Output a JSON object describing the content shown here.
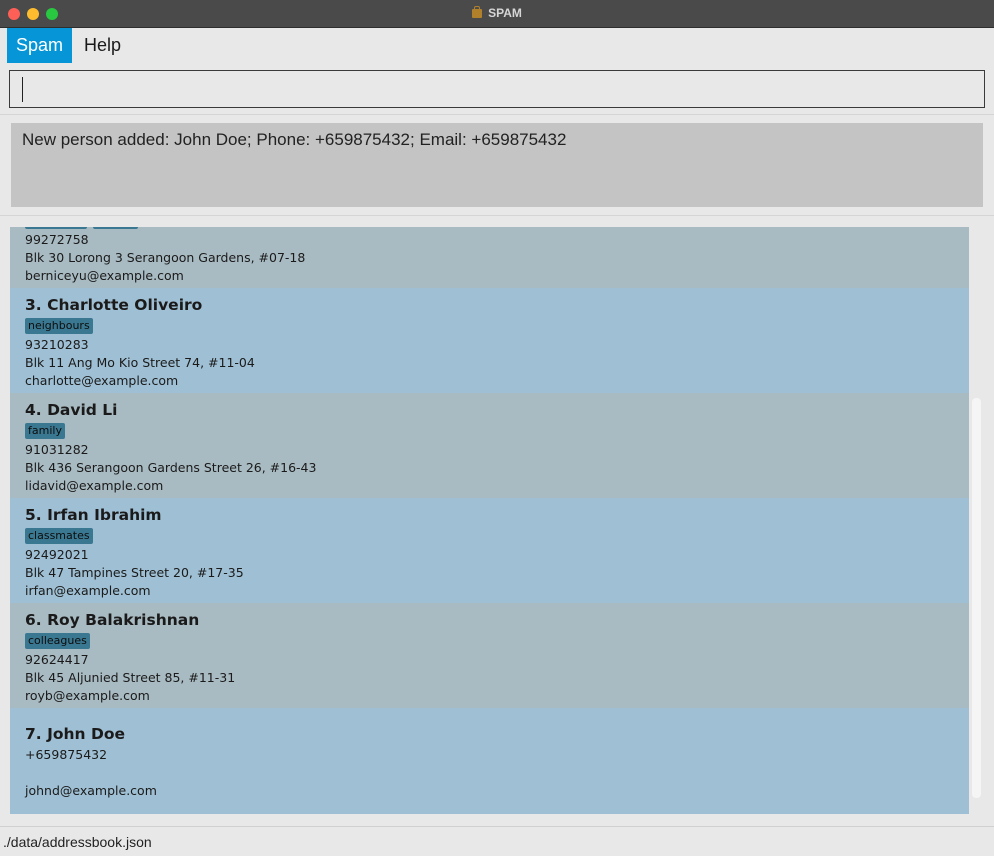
{
  "window": {
    "title": "SPAM"
  },
  "menu": {
    "items": [
      "Spam",
      "Help"
    ]
  },
  "command": {
    "value": "",
    "placeholder": ""
  },
  "result": {
    "message": "New person added: John Doe; Phone: +659875432; Email: +659875432"
  },
  "persons_partial": {
    "phone": "99272758",
    "address": "Blk 30 Lorong 3 Serangoon Gardens, #07-18",
    "email": "berniceyu@example.com"
  },
  "persons": [
    {
      "name": "3.  Charlotte Oliveiro",
      "tag": "neighbours",
      "phone": "93210283",
      "address": "Blk 11 Ang Mo Kio Street 74, #11-04",
      "email": "charlotte@example.com"
    },
    {
      "name": "4.  David Li",
      "tag": "family",
      "phone": "91031282",
      "address": "Blk 436 Serangoon Gardens Street 26, #16-43",
      "email": "lidavid@example.com"
    },
    {
      "name": "5.  Irfan Ibrahim",
      "tag": "classmates",
      "phone": "92492021",
      "address": "Blk 47 Tampines Street 20, #17-35",
      "email": "irfan@example.com"
    },
    {
      "name": "6.  Roy Balakrishnan",
      "tag": "colleagues",
      "phone": "92624417",
      "address": "Blk 45 Aljunied Street 85, #11-31",
      "email": "royb@example.com"
    },
    {
      "name": "7.  John Doe",
      "tag": "",
      "phone": "+659875432",
      "address": "",
      "email": "johnd@example.com"
    }
  ],
  "status": {
    "path": "./data/addressbook.json"
  },
  "colors": {
    "accent": "#0696d7",
    "card_grey": "#a9bbc2",
    "card_blue": "#9fc0d4",
    "tag": "#3a7892"
  }
}
